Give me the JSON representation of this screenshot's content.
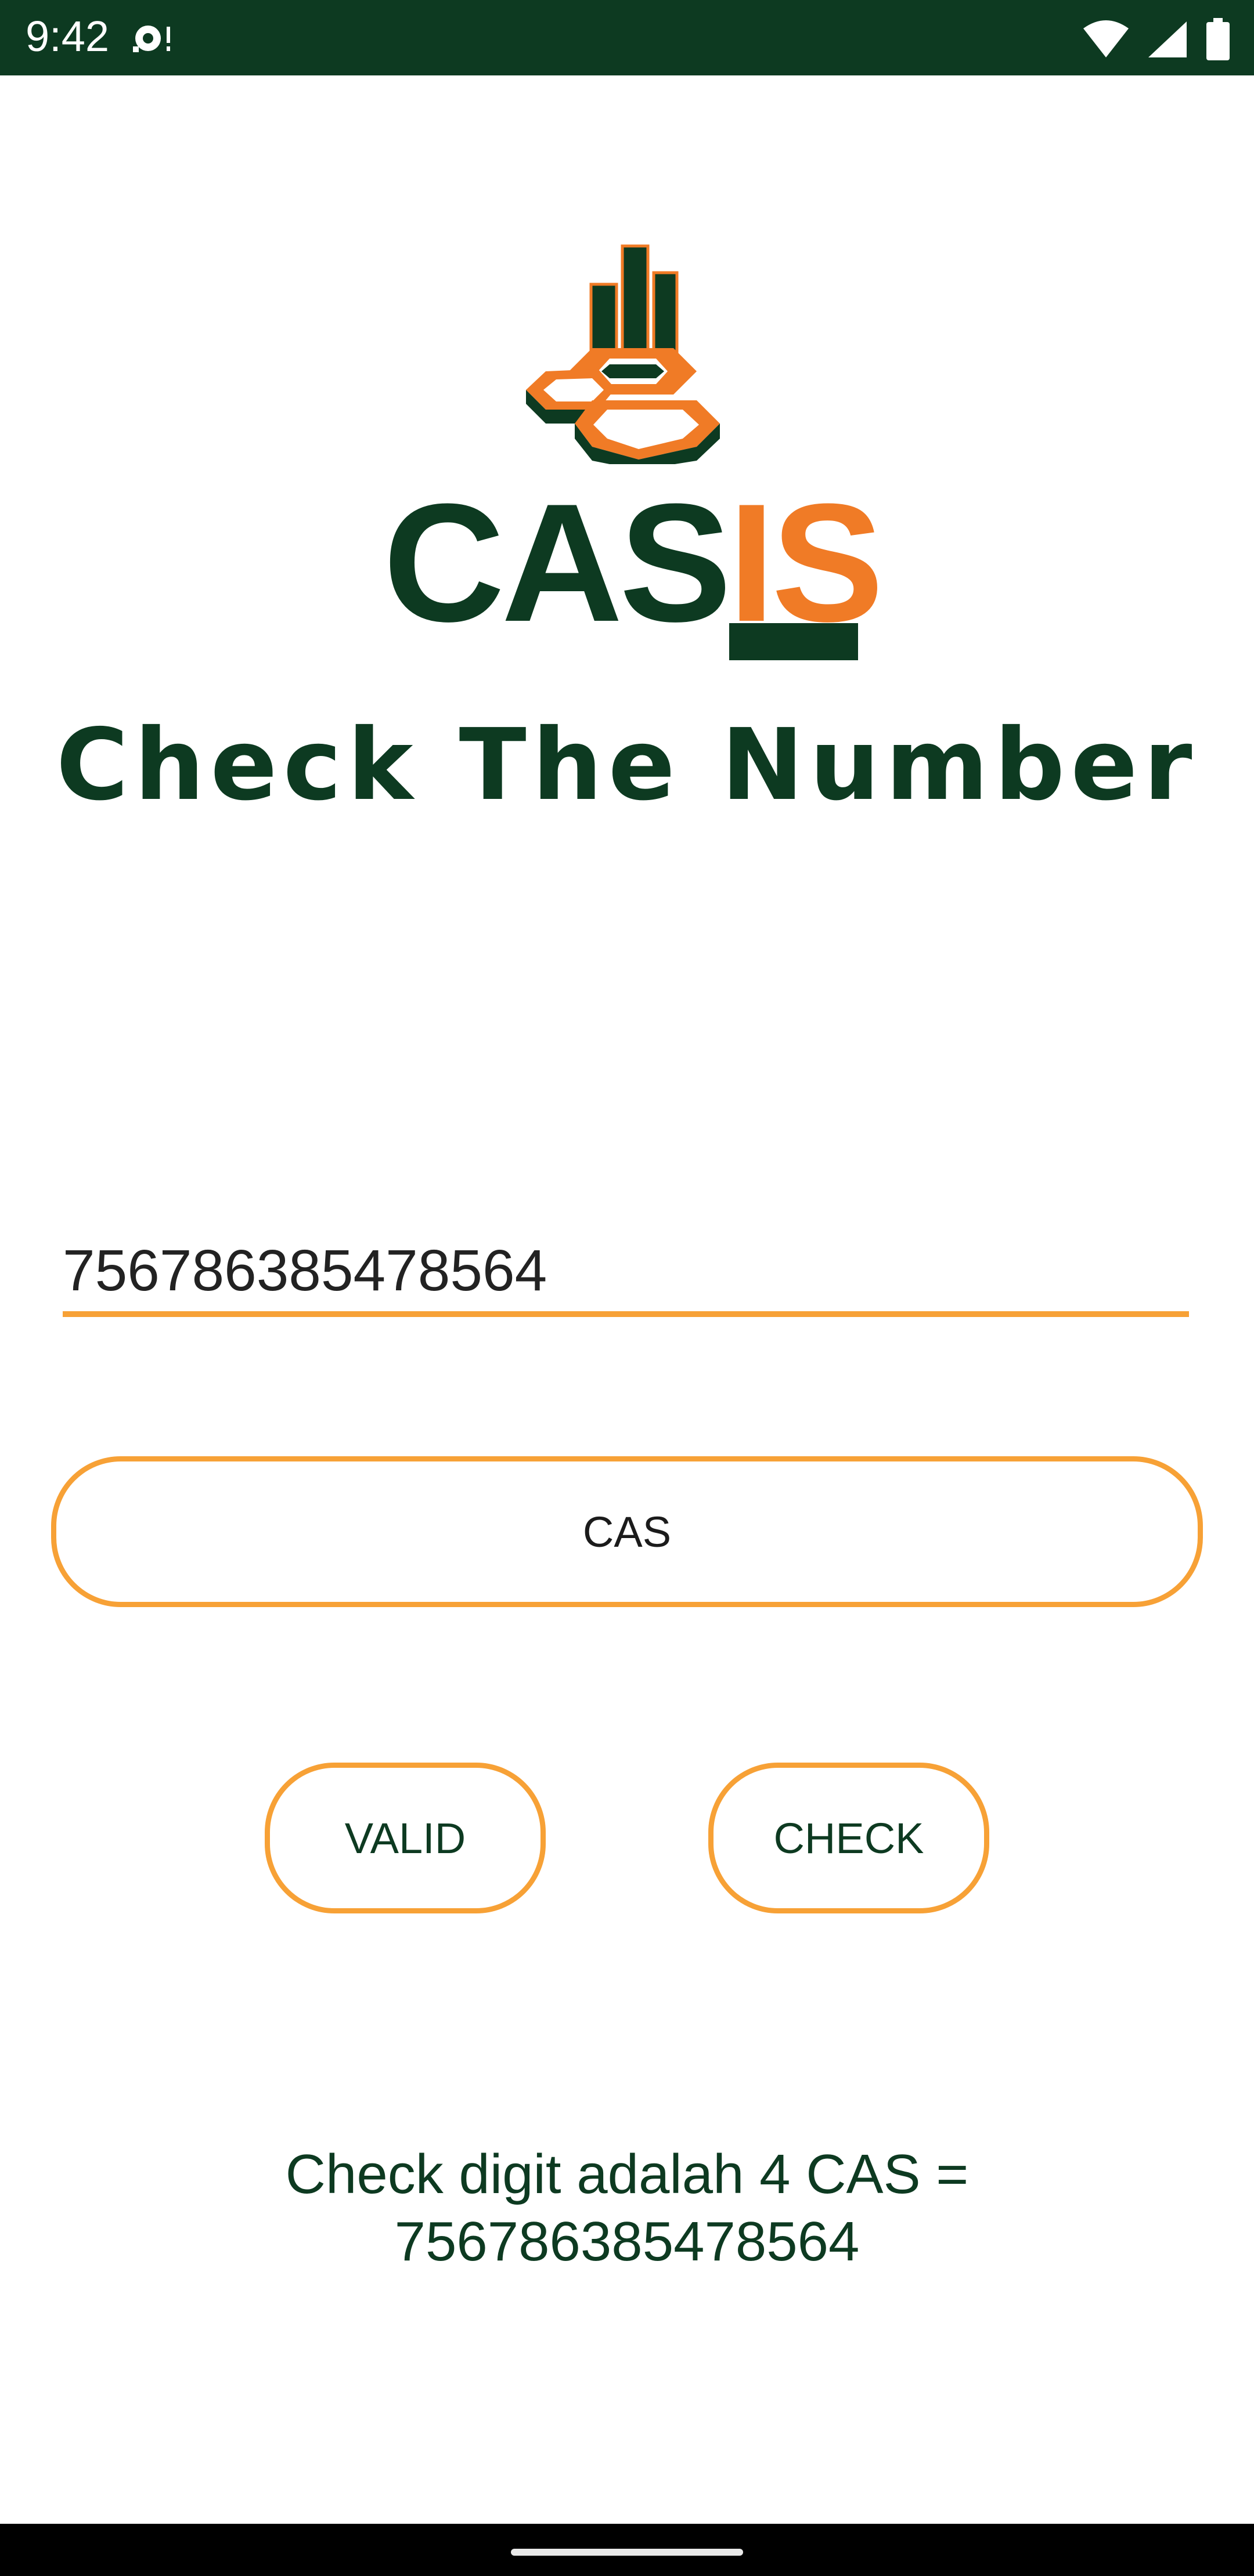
{
  "status_bar": {
    "time": "9:42",
    "icons": [
      "notification-icon",
      "wifi-icon",
      "signal-icon",
      "battery-icon"
    ]
  },
  "logo": {
    "text_cas": "CAS",
    "text_is": "IS",
    "colors": {
      "primary": "#0d3a21",
      "accent": "#f07b26"
    }
  },
  "title": "Check The Number",
  "input": {
    "value": "756786385478564"
  },
  "buttons": {
    "cas_label": "CAS",
    "valid_label": "VALID",
    "check_label": "CHECK"
  },
  "result": "Check digit adalah 4 CAS =\n756786385478564",
  "colors": {
    "status_bar": "#0d3a21",
    "accent_orange": "#f7a136",
    "text_dark_green": "#0d3a21"
  }
}
